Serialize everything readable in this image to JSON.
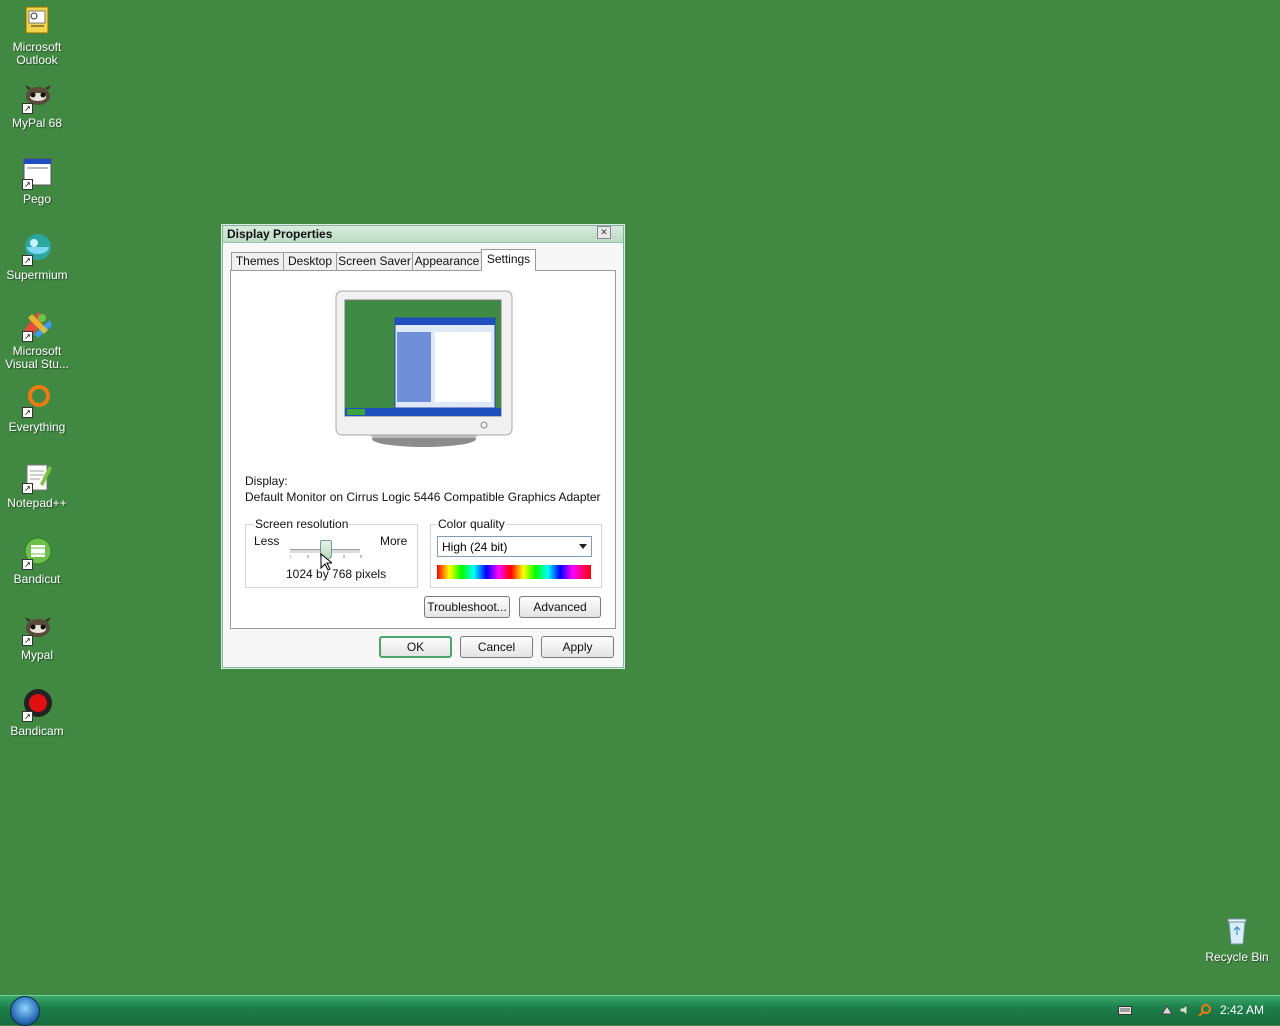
{
  "desktop": {
    "background_color": "#418843",
    "icons": [
      {
        "label": "Microsoft Outlook",
        "line1": "Microsoft",
        "line2": "Outlook",
        "icon": "outlook-icon"
      },
      {
        "label": "MyPal 68",
        "icon": "mypal-icon"
      },
      {
        "label": "Pego",
        "icon": "pego-icon"
      },
      {
        "label": "Supermium",
        "icon": "supermium-icon"
      },
      {
        "label": "Microsoft Visual Stu...",
        "line1": "Microsoft",
        "line2": "Visual Stu...",
        "icon": "visual-studio-icon"
      },
      {
        "label": "Everything",
        "icon": "everything-icon"
      },
      {
        "label": "Notepad++",
        "icon": "notepad-plus-plus-icon"
      },
      {
        "label": "Bandicut",
        "icon": "bandicut-icon"
      },
      {
        "label": "Mypal",
        "icon": "mypal-icon"
      },
      {
        "label": "Bandicam",
        "icon": "bandicam-icon"
      }
    ],
    "recycle_bin": {
      "label": "Recycle Bin",
      "icon": "recycle-bin-icon"
    }
  },
  "dialog": {
    "title": "Display Properties",
    "close_glyph": "✕",
    "tabs": [
      {
        "label": "Themes",
        "active": false
      },
      {
        "label": "Desktop",
        "active": false
      },
      {
        "label": "Screen Saver",
        "active": false
      },
      {
        "label": "Appearance",
        "active": false
      },
      {
        "label": "Settings",
        "active": true
      }
    ],
    "display_label": "Display:",
    "display_value": "Default Monitor on Cirrus Logic 5446 Compatible Graphics Adapter",
    "screen_resolution": {
      "group_label": "Screen resolution",
      "less_label": "Less",
      "more_label": "More",
      "value_text": "1024 by 768 pixels",
      "slider_position_fraction": 0.5
    },
    "color_quality": {
      "group_label": "Color quality",
      "selected": "High (24 bit)"
    },
    "buttons": {
      "troubleshoot": "Troubleshoot...",
      "advanced": "Advanced",
      "ok": "OK",
      "cancel": "Cancel",
      "apply": "Apply"
    }
  },
  "taskbar": {
    "clock": "2:42 AM",
    "accent_color": "#1c7f4a"
  }
}
